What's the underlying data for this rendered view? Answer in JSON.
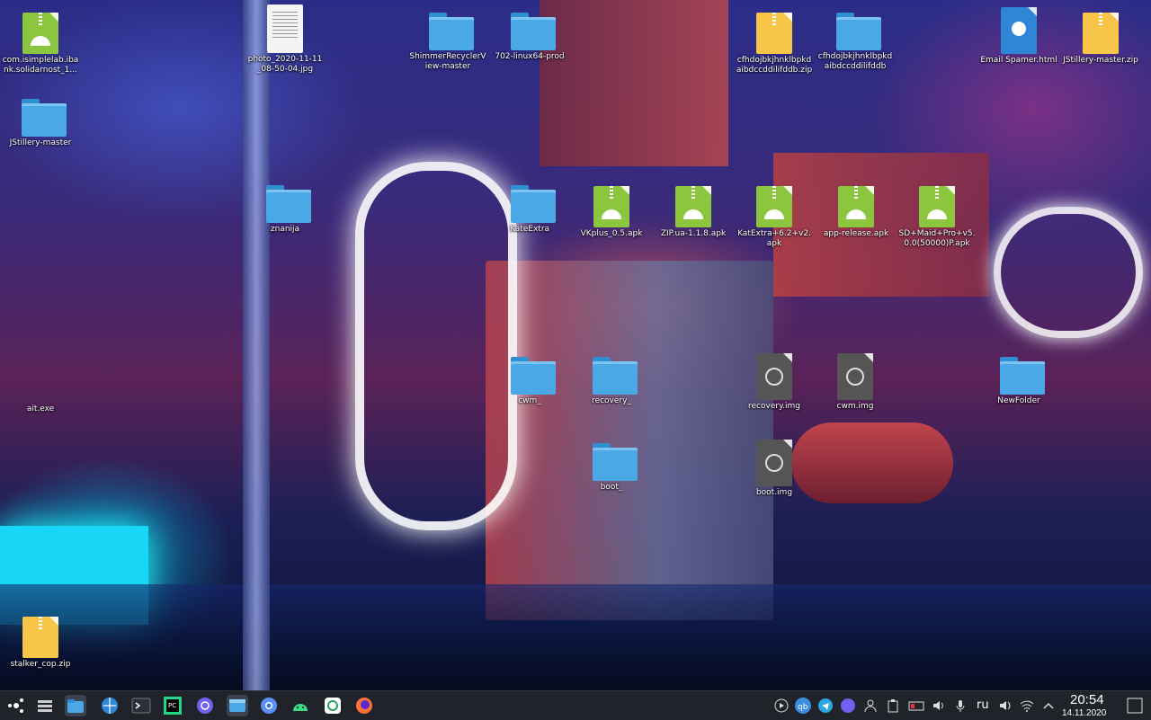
{
  "desktop": {
    "icons": [
      {
        "label": "com.isimplelab.ibank.solidarnost_1...",
        "type": "apk"
      },
      {
        "label": "photo_2020-11-11_08-50-04.jpg",
        "type": "jpg"
      },
      {
        "label": "ShimmerRecyclerView-master",
        "type": "folder"
      },
      {
        "label": "702-linux64-prod",
        "type": "folder"
      },
      {
        "label": "cfhdojbkjhnklbpkdaibdccddilifddb.zip",
        "type": "zip"
      },
      {
        "label": "cfhdojbkjhnklbpkdaibdccddilifddb",
        "type": "folder"
      },
      {
        "label": "Email Spamer.html",
        "type": "html"
      },
      {
        "label": "JStillery-master.zip",
        "type": "zip"
      },
      {
        "label": "JStillery-master",
        "type": "folder"
      },
      {
        "label": "znanija",
        "type": "folder"
      },
      {
        "label": "KateExtra",
        "type": "folder"
      },
      {
        "label": "VKplus_0.5.apk",
        "type": "apk"
      },
      {
        "label": "ZIP.ua-1.1.8.apk",
        "type": "apk"
      },
      {
        "label": "KatExtra+6.2+v2.apk",
        "type": "apk"
      },
      {
        "label": "app-release.apk",
        "type": "apk"
      },
      {
        "label": "SD+Maid+Pro+v5.0.0(50000)P.apk",
        "type": "apk"
      },
      {
        "label": "ait.exe",
        "type": "exe"
      },
      {
        "label": "cwm_",
        "type": "folder"
      },
      {
        "label": "recovery_",
        "type": "folder"
      },
      {
        "label": "recovery.img",
        "type": "img"
      },
      {
        "label": "cwm.img",
        "type": "img"
      },
      {
        "label": "NewFolder",
        "type": "folder"
      },
      {
        "label": "boot_",
        "type": "folder"
      },
      {
        "label": "boot.img",
        "type": "img"
      },
      {
        "label": "stalker_cop.zip",
        "type": "zip"
      }
    ]
  },
  "taskbar": {
    "launcher_icon": "application-launcher-icon",
    "pinned": [
      "system-monitor-icon",
      "file-manager-icon",
      "browser-globe-icon",
      "terminal-icon",
      "pycharm-icon",
      "viber-icon",
      "disk-app-icon",
      "chromium-icon",
      "android-studio-icon",
      "vpn-icon",
      "firefox-icon"
    ],
    "tray": {
      "language": "ru",
      "icons": [
        "media-player-icon",
        "qbittorrent-icon",
        "telegram-icon",
        "viber-tray-icon",
        "user-switch-icon",
        "clipboard-icon",
        "battery-icon",
        "volume-icon",
        "microphone-icon",
        "speaker-icon",
        "wifi-icon",
        "expand-tray-icon"
      ],
      "clock_time": "20:54",
      "clock_date": "14.11.2020",
      "show_desktop_icon": "show-desktop-icon"
    }
  },
  "colors": {
    "taskbar_bg": "#20232a",
    "folder": "#4aa8e6",
    "apk": "#8cc63f",
    "zip": "#f7c548"
  }
}
